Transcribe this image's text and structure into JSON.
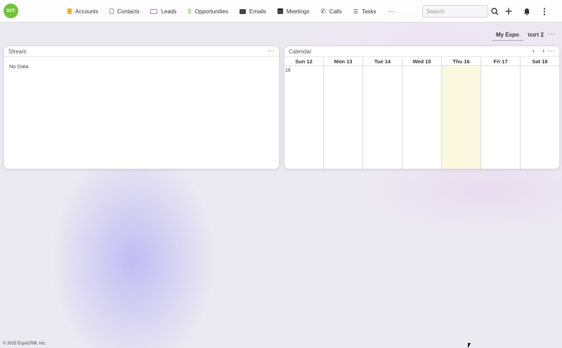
{
  "logo": {
    "text": "DOT."
  },
  "nav": {
    "tabs": [
      {
        "label": "Accounts",
        "icon": "accounts-icon",
        "color": "#f0b429"
      },
      {
        "label": "Contacts",
        "icon": "contacts-icon",
        "color": "#6fa8dc"
      },
      {
        "label": "Leads",
        "icon": "leads-icon",
        "color": "#c770c7"
      },
      {
        "label": "Opportunities",
        "icon": "dollar-icon",
        "color": "#72c23a"
      },
      {
        "label": "Emails",
        "icon": "envelope-icon",
        "color": "#444444"
      },
      {
        "label": "Meetings",
        "icon": "calendar-icon",
        "color": "#444444"
      },
      {
        "label": "Calls",
        "icon": "phone-icon",
        "color": "#444444"
      },
      {
        "label": "Tasks",
        "icon": "tasks-icon",
        "color": "#444444"
      }
    ],
    "more_label": "···",
    "search_placeholder": "Search"
  },
  "dashboard": {
    "tabs": [
      {
        "label": "My Espo",
        "active": true
      },
      {
        "label": "τεστ 2",
        "active": false
      }
    ],
    "menu_label": "···"
  },
  "stream": {
    "title": "Stream",
    "menu_label": "···",
    "empty_text": "No Data"
  },
  "calendar": {
    "title": "Calendar",
    "menu_label": "···",
    "prev_label": "‹",
    "next_label": "›",
    "week_number": "16",
    "days": [
      {
        "label": "Sun 12",
        "today": false
      },
      {
        "label": "Mon 13",
        "today": false
      },
      {
        "label": "Tue 14",
        "today": false
      },
      {
        "label": "Wed 15",
        "today": false
      },
      {
        "label": "Thu 16",
        "today": true
      },
      {
        "label": "Fri 17",
        "today": false
      },
      {
        "label": "Sat 18",
        "today": false
      }
    ],
    "today_color": "#fbf8e0"
  },
  "footer": {
    "text": "© 2025 EspoCRM, Inc."
  }
}
